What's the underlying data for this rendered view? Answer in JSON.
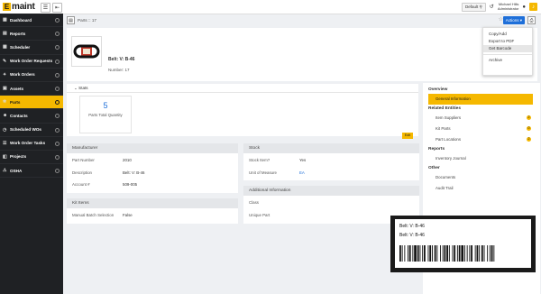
{
  "app": {
    "logo_letter": "E",
    "logo_text": "maint"
  },
  "topbar": {
    "default_label": "Default",
    "user_name": "Michael Hills",
    "user_role": "Administrator"
  },
  "sidebar": {
    "items": [
      {
        "label": "Dashboard",
        "icon": "dashboard-icon",
        "glyph": "▦"
      },
      {
        "label": "Reports",
        "icon": "reports-icon",
        "glyph": "▤"
      },
      {
        "label": "Scheduler",
        "icon": "scheduler-icon",
        "glyph": "▦"
      },
      {
        "label": "Work Order Requests",
        "icon": "requests-icon",
        "glyph": "✎"
      },
      {
        "label": "Work Orders",
        "icon": "wrench-icon",
        "glyph": "✦"
      },
      {
        "label": "Assets",
        "icon": "assets-icon",
        "glyph": "▣"
      },
      {
        "label": "Parts",
        "icon": "gears-icon",
        "glyph": "✲",
        "active": true
      },
      {
        "label": "Contacts",
        "icon": "contacts-icon",
        "glyph": "☻"
      },
      {
        "label": "Scheduled WOs",
        "icon": "scheduled-icon",
        "glyph": "◷"
      },
      {
        "label": "Work Order Tasks",
        "icon": "tasks-icon",
        "glyph": "☰"
      },
      {
        "label": "Projects",
        "icon": "projects-icon",
        "glyph": "◧"
      },
      {
        "label": "OSHA",
        "icon": "osha-icon",
        "glyph": "⚠"
      }
    ]
  },
  "breadcrumb": {
    "text": "Parts :: 17"
  },
  "toolbar": {
    "actions_label": "Actions ▾"
  },
  "part": {
    "title": "Belt: V: B-46",
    "number_label": "Number: 17"
  },
  "header_side": {
    "cre_label": "Cre",
    "upd_label": "Upd",
    "upd_value": "30"
  },
  "actions_menu": {
    "items": [
      "Copy/Add",
      "Export to PDF",
      "Get Barcode",
      "Archive"
    ],
    "highlighted": "Get Barcode"
  },
  "stats": {
    "header": "Stats",
    "value": "5",
    "label": "Parts Total Quantity"
  },
  "edit_label": "Edit",
  "manufacturer": {
    "title": "Manufacturer",
    "rows": [
      {
        "label": "Part Number",
        "value": "2010"
      },
      {
        "label": "Description",
        "value": "Belt: V: B-46"
      },
      {
        "label": "Account #",
        "value": "509-005"
      }
    ]
  },
  "stock": {
    "title": "Stock",
    "rows": [
      {
        "label": "Stock Item?",
        "value": "Yes"
      },
      {
        "label": "Unit of Measure",
        "value": "EA"
      }
    ]
  },
  "kit_items": {
    "title": "Kit Items",
    "rows": [
      {
        "label": "Manual Batch Selection",
        "value": "False"
      }
    ]
  },
  "additional": {
    "title": "Additional Information",
    "rows": [
      {
        "label": "Class",
        "value": ""
      },
      {
        "label": "Unique Part",
        "value": ""
      }
    ]
  },
  "right_panel": {
    "overview": "Overview",
    "general": "General Information",
    "related": "Related Entities",
    "related_items": [
      {
        "label": "Item Suppliers",
        "count": "2"
      },
      {
        "label": "Kit Parts",
        "count": "0"
      },
      {
        "label": "Part Locations",
        "count": "2"
      }
    ],
    "reports": "Reports",
    "report_items": [
      "Inventory Journal"
    ],
    "other": "Other",
    "other_items": [
      "Documents",
      "Audit Trail"
    ]
  },
  "barcode": {
    "line1": "Belt: V: B-46",
    "line2": "Belt: V: B-46"
  },
  "colors": {
    "accent": "#f5b800",
    "sidebar": "#1f2124",
    "link": "#1e6fd9"
  }
}
